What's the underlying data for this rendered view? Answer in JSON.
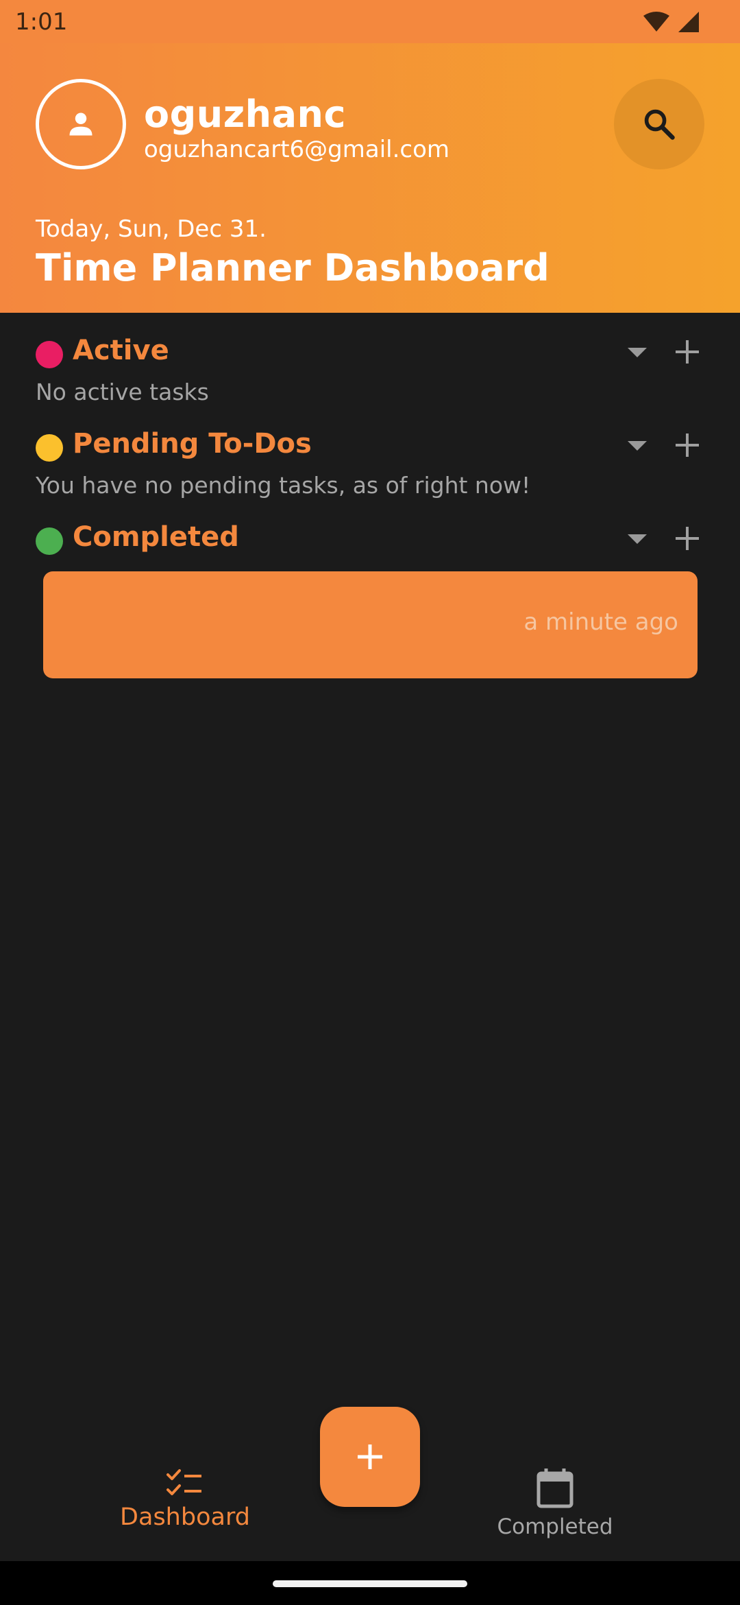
{
  "status_bar": {
    "time": "1:01"
  },
  "user": {
    "name": "oguzhanc",
    "email": "oguzhancart6@gmail.com"
  },
  "header": {
    "date": "Today, Sun, Dec 31.",
    "title": "Time Planner Dashboard"
  },
  "sections": [
    {
      "title": "Active",
      "dot_color": "#e91e63",
      "message": "No active tasks"
    },
    {
      "title": "Pending To-Dos",
      "dot_color": "#fbc02d",
      "message": "You have no pending tasks, as of right now!"
    },
    {
      "title": "Completed",
      "dot_color": "#4caf50"
    }
  ],
  "completed_tasks": [
    {
      "time_ago": "a minute ago"
    }
  ],
  "nav": {
    "items": [
      {
        "label": "Dashboard",
        "icon": "checklist-icon",
        "active": true
      },
      {
        "label": "Completed",
        "icon": "calendar-icon",
        "active": false
      }
    ],
    "fab_icon": "plus-icon"
  },
  "colors": {
    "accent": "#f4883e",
    "header_gradient_end": "#f5a22c",
    "background": "#1b1b1b"
  }
}
